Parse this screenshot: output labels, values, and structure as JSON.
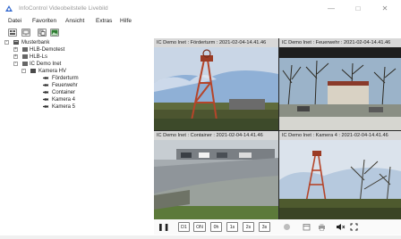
{
  "window": {
    "title": "InfoControl Videobeitstelle Livebild",
    "minimize_glyph": "—",
    "maximize_glyph": "□",
    "close_glyph": "✕"
  },
  "menu": {
    "items": [
      "Datei",
      "Favoriten",
      "Ansicht",
      "Extras",
      "Hilfe"
    ]
  },
  "toolbar": {
    "icons": [
      "camera-layout-icon",
      "monitor-icon",
      "copy-icon",
      "image-icon"
    ]
  },
  "tree": {
    "root": "Musterbank",
    "children": [
      "HLB-Demotest",
      "HLB-Ls",
      "IC Demo Inet"
    ],
    "group": "Kamera HV",
    "cameras": [
      "Förderturm",
      "Feuerwehr",
      "Container",
      "Kamera 4",
      "Kamera 5"
    ]
  },
  "cameras": [
    {
      "header": "IC Demo Inet : Förderturm : 2021-02-04-14.41.46"
    },
    {
      "header": "IC Demo Inet : Feuerwehr : 2021-02-04-14.41.46"
    },
    {
      "header": "IC Demo Inet : Container : 2021-02-04-14.41.46"
    },
    {
      "header": "IC Demo Inet : Kamera 4 : 2021-02-04-14.41.46"
    }
  ],
  "playback": {
    "pause_glyph": "❚❚",
    "buttons": [
      "D1",
      "ON",
      "0h",
      "1s",
      "2s",
      "3s"
    ],
    "icons": [
      "record-icon",
      "calendar-icon",
      "print-icon",
      "mute-icon",
      "fullscreen-icon"
    ]
  },
  "colors": {
    "header_bg": "#d8d8d8",
    "video_bg": "#2a2a2a",
    "tower_red": "#b5452a",
    "sky_blue": "#7a9ec8"
  }
}
